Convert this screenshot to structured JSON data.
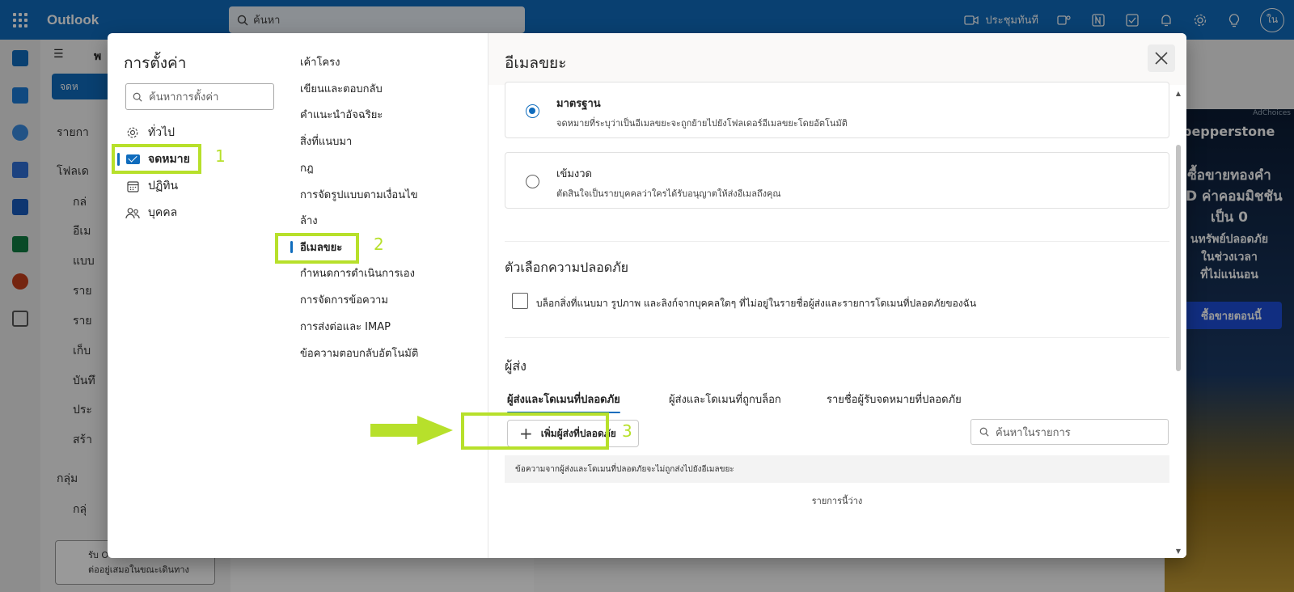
{
  "app": {
    "name": "Outlook",
    "search_placeholder": "ค้นหา",
    "meet_now_label": "ประชุมทันที",
    "avatar_initials": "ใน"
  },
  "background": {
    "nav_partial_1": "พ",
    "new_mail_partial": "จดห",
    "nav_lines": [
      "รายกา",
      "โฟลเด",
      "กล่",
      "อีเม",
      "แบบ",
      "ราย",
      "ราย",
      "เก็บ",
      "บันทึ",
      "ประ",
      "สร้า",
      "กลุ่ม",
      "กลุ่"
    ],
    "promo_text_1": "รับ O",
    "promo_text_2": "ต่ออยู่เสมอในขณะเดินทาง",
    "ad": {
      "choices": "AdChoices",
      "brand": "pepperstone",
      "lines": [
        "ซื้อขายทองคำ",
        "FD ค่าคอมมิชชัน",
        "เป็น 0",
        "นทรัพย์ปลอดภัย",
        "ในช่วงเวลา",
        "ที่ไม่แน่นอน"
      ],
      "cta": "ซื้อขายตอนนี้"
    }
  },
  "settings": {
    "title": "การตั้งค่า",
    "search_placeholder": "ค้นหาการตั้งค่า",
    "categories": [
      {
        "label": "ทั่วไป",
        "icon": "gear-icon"
      },
      {
        "label": "จดหมาย",
        "icon": "mail-icon",
        "active": true
      },
      {
        "label": "ปฏิทิน",
        "icon": "calendar-icon"
      },
      {
        "label": "บุคคล",
        "icon": "people-icon"
      }
    ],
    "mail_sections": [
      "เค้าโครง",
      "เขียนและตอบกลับ",
      "คำแนะนำอัจฉริยะ",
      "สิ่งที่แนบมา",
      "กฎ",
      "การจัดรูปแบบตามเงื่อนไข",
      "ล้าง",
      "อีเมลขยะ",
      "กำหนดการดำเนินการเอง",
      "การจัดการข้อความ",
      "การส่งต่อและ IMAP",
      "ข้อความตอบกลับอัตโนมัติ"
    ],
    "active_section_index": 7
  },
  "junk": {
    "title": "อีเมลขยะ",
    "options": [
      {
        "title": "มาตรฐาน",
        "desc": "จดหมายที่ระบุว่าเป็นอีเมลขยะจะถูกย้ายไปยังโฟลเดอร์อีเมลขยะโดยอัตโนมัติ",
        "selected": true
      },
      {
        "title": "เข้มงวด",
        "desc": "ตัดสินใจเป็นรายบุคคลว่าใครได้รับอนุญาตให้ส่งอีเมลถึงคุณ",
        "selected": false
      }
    ],
    "safety_heading": "ตัวเลือกความปลอดภัย",
    "block_label": "บล็อกสิ่งที่แนบมา รูปภาพ และลิงก์จากบุคคลใดๆ ที่ไม่อยู่ในรายชื่อผู้ส่งและรายการโดเมนที่ปลอดภัยของฉัน",
    "block_checked": false,
    "senders_heading": "ผู้ส่ง",
    "tabs": [
      "ผู้ส่งและโดเมนที่ปลอดภัย",
      "ผู้ส่งและโดเมนที่ถูกบล็อก",
      "รายชื่อผู้รับจดหมายที่ปลอดภัย"
    ],
    "active_tab": 0,
    "add_button": "เพิ่มผู้ส่งที่ปลอดภัย",
    "list_search_placeholder": "ค้นหาในรายการ",
    "info_text": "ข้อความจากผู้ส่งและโดเมนที่ปลอดภัยจะไม่ถูกส่งไปยังอีเมลขยะ",
    "empty_text": "รายการนี้ว่าง"
  },
  "annotations": {
    "step_1": "1",
    "step_2": "2",
    "step_3": "3",
    "highlight_color": "#b7e02b"
  },
  "colors": {
    "brand_blue": "#0f6cbd",
    "annotation_green": "#b7e02b"
  }
}
